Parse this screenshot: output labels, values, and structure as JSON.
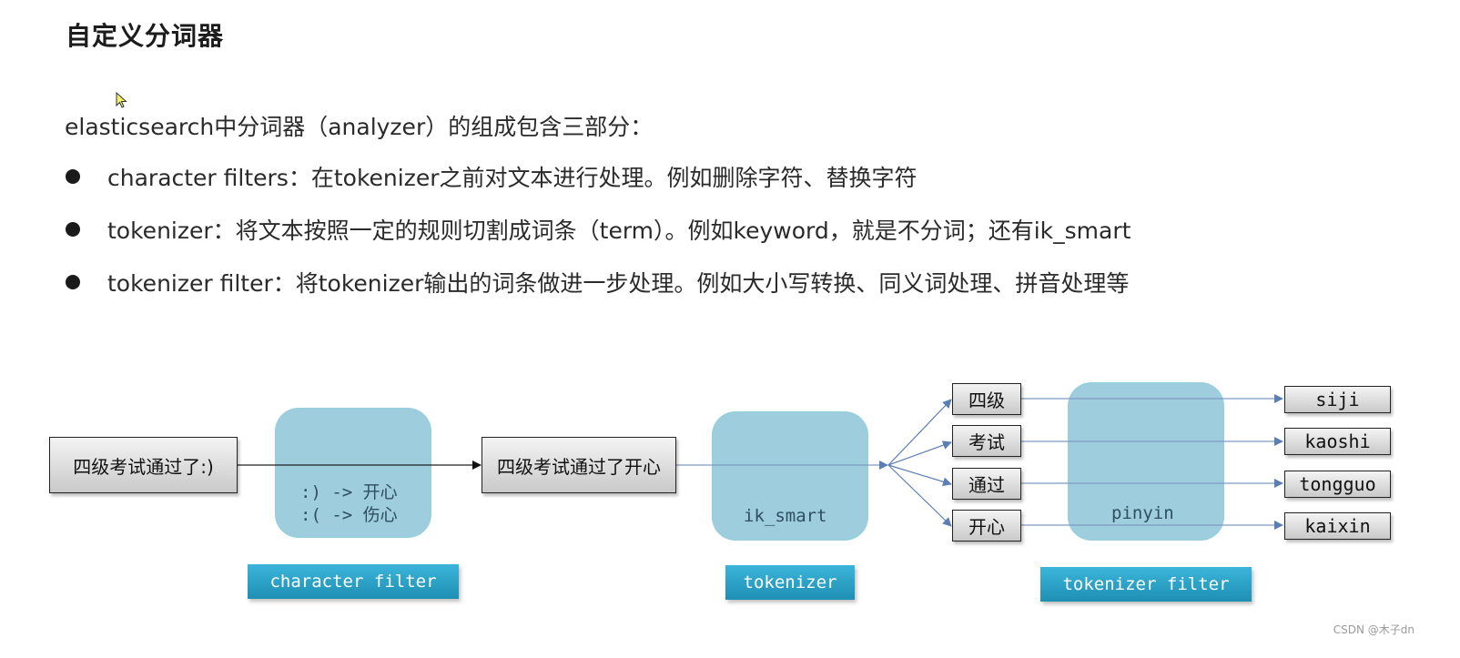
{
  "title": "自定义分词器",
  "intro": "elasticsearch中分词器（analyzer）的组成包含三部分：",
  "bullets": [
    "character filters：在tokenizer之前对文本进行处理。例如删除字符、替换字符",
    "tokenizer：将文本按照一定的规则切割成词条（term）。例如keyword，就是不分词；还有ik_smart",
    "tokenizer filter：将tokenizer输出的词条做进一步处理。例如大小写转换、同义词处理、拼音处理等"
  ],
  "diagram": {
    "input_text": "四级考试通过了:)",
    "char_filter_rules": [
      ":) -> 开心",
      ":( -> 伤心"
    ],
    "after_char_filter": "四级考试通过了开心",
    "tokenizer_name": "ik_smart",
    "tokens": [
      "四级",
      "考试",
      "通过",
      "开心"
    ],
    "token_filter_name": "pinyin",
    "outputs": [
      "siji",
      "kaoshi",
      "tongguo",
      "kaixin"
    ],
    "labels": {
      "character_filter": "character filter",
      "tokenizer": "tokenizer",
      "tokenizer_filter": "tokenizer filter"
    },
    "colors": {
      "panel": "#9fd0df",
      "label_top": "#3cb4da",
      "label_bottom": "#1e90b4",
      "arrow": "#5b7fb5"
    }
  },
  "watermark": "CSDN @木子dn"
}
